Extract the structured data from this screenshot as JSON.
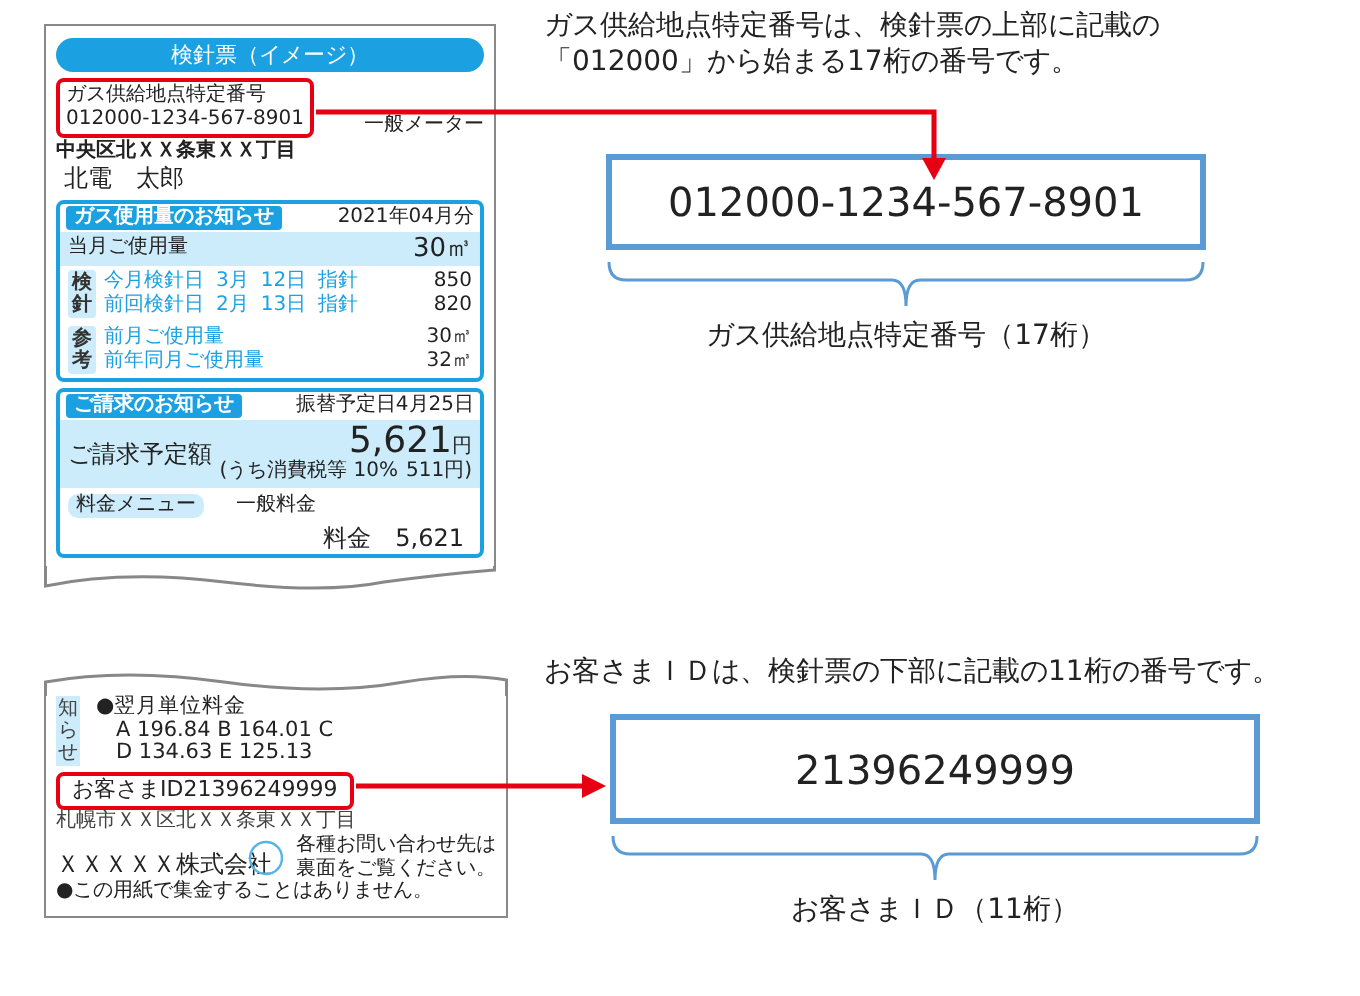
{
  "top_slip": {
    "title": "検針票（イメージ）",
    "supply_point": {
      "label": "ガス供給地点特定番号",
      "value": "012000-1234-567-8901"
    },
    "meter_type": "一般メーター",
    "address": "中央区北ＸＸ条東ＸＸ丁目",
    "name": "北電　太郎",
    "usage": {
      "title": "ガス使用量のお知らせ",
      "period": "2021年04月分",
      "current": {
        "label": "当月ご使用量",
        "value": "30㎥"
      },
      "groups": [
        {
          "label": "検針",
          "rows": [
            {
              "label": "今月検針日",
              "month": "3月",
              "day": "12日",
              "reading_label": "指針",
              "value": "850"
            },
            {
              "label": "前回検針日",
              "month": "2月",
              "day": "13日",
              "reading_label": "指針",
              "value": "820"
            }
          ]
        },
        {
          "label": "参考",
          "rows": [
            {
              "label": "前月ご使用量",
              "value": "30㎥"
            },
            {
              "label": "前年同月ご使用量",
              "value": "32㎥"
            }
          ]
        }
      ]
    },
    "billing": {
      "title": "ご請求のお知らせ",
      "transfer_date": "振替予定日4月25日",
      "amount_label": "ご請求予定額",
      "amount": "5,621",
      "currency": "円",
      "tax_note": "(うち消費税等 10%",
      "tax_amount": "511円)",
      "menu_label": "料金メニュー",
      "menu": "一般料金",
      "cut_label": "料金",
      "cut_value": "5,621"
    }
  },
  "bottom_slip": {
    "side_tab": "知らせ",
    "unit_price_title": "●翌月単位料金",
    "unit_price_lines": [
      "A 196.84 B 164.01 C",
      "D 134.63 E 125.13"
    ],
    "customer_id": "お客さまID21396249999",
    "company_address": "札幌市ＸＸ区北ＸＸ条東ＸＸ丁目",
    "company": "ＸＸＸＸＸ株式会社",
    "contact_note": [
      "各種お問い合わせ先は",
      "裏面をご覧ください。"
    ],
    "footer_note": "●この用紙で集金することはありません。"
  },
  "callouts": [
    {
      "description": "ガス供給地点特定番号は、検針票の上部に記載の「012000」から始まる17桁の番号です。",
      "number": "012000-1234-567-8901",
      "caption": "ガス供給地点特定番号（17桁）"
    },
    {
      "description": "お客さまＩＤは、検針票の下部に記載の11桁の番号です。",
      "number": "21396249999",
      "caption": "お客さまＩＤ（11桁）"
    }
  ]
}
